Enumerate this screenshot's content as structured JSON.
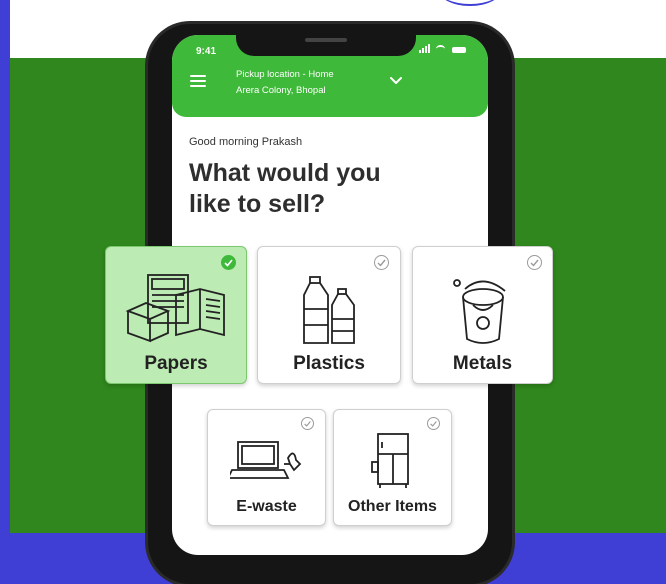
{
  "status_bar": {
    "time": "9:41"
  },
  "header": {
    "pickup_title": "Pickup location - Home",
    "pickup_address": "Arera Colony, Bhopal"
  },
  "greeting": "Good morning Prakash",
  "question_line1": "What would you",
  "question_line2": "like to sell?",
  "categories": [
    {
      "label": "Papers",
      "icon": "newspaper-icon",
      "selected": true
    },
    {
      "label": "Plastics",
      "icon": "plastic-bottles-icon",
      "selected": false
    },
    {
      "label": "Metals",
      "icon": "metal-bucket-icon",
      "selected": false
    },
    {
      "label": "E-waste",
      "icon": "laptop-icon",
      "selected": false
    },
    {
      "label": "Other Items",
      "icon": "refrigerator-icon",
      "selected": false
    }
  ],
  "colors": {
    "brand_green": "#3fb93a",
    "background_green": "#2f871d",
    "selected_card": "#bcebb3",
    "frame_blue": "#3f3fd6"
  }
}
